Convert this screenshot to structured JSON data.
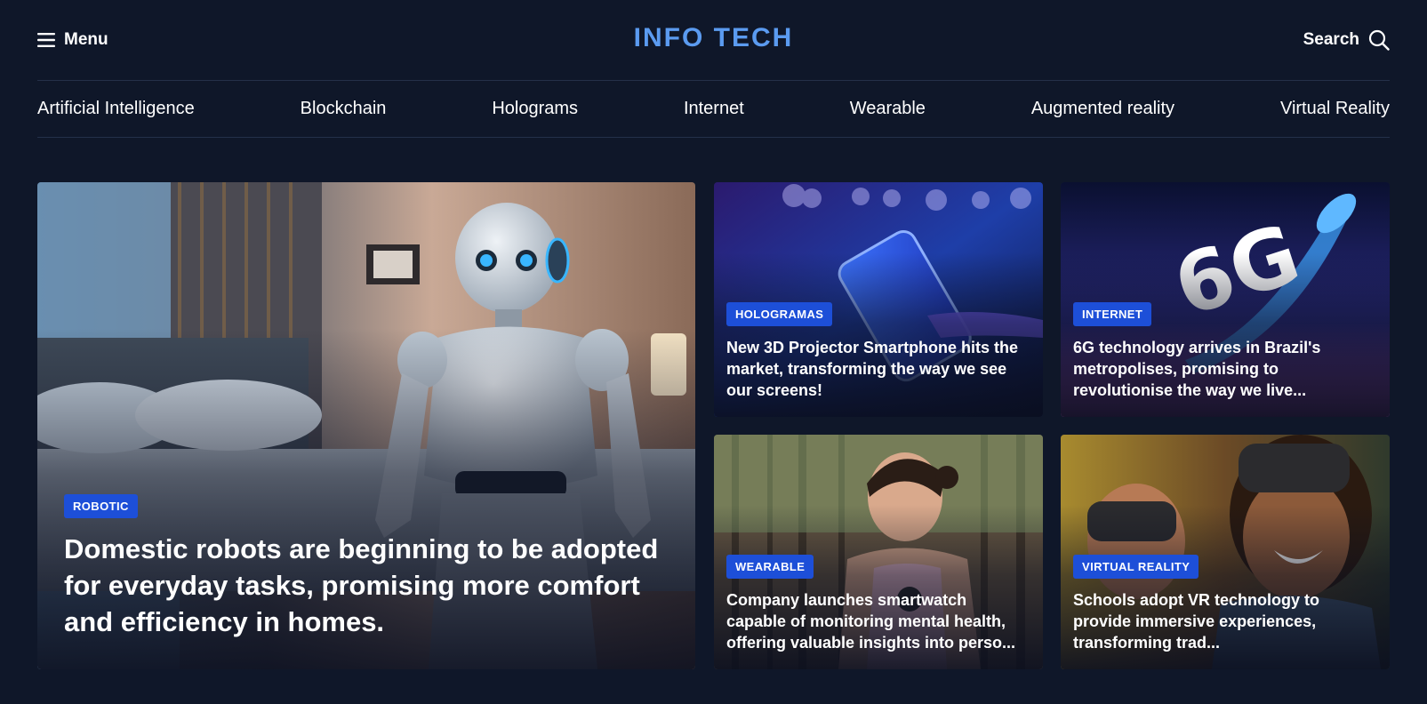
{
  "header": {
    "menu_label": "Menu",
    "brand": "INFO TECH",
    "search_label": "Search"
  },
  "nav": {
    "items": [
      "Artificial Intelligence",
      "Blockchain",
      "Holograms",
      "Internet",
      "Wearable",
      "Augmented reality",
      "Virtual Reality"
    ]
  },
  "articles": [
    {
      "badge": "ROBOTIC",
      "title": "Domestic robots are beginning to be adopted for everyday tasks, promising more comfort and efficiency in homes."
    },
    {
      "badge": "HOLOGRAMAS",
      "title": "New 3D Projector Smartphone hits the market, transforming the way we see our screens!"
    },
    {
      "badge": "INTERNET",
      "title": "6G technology arrives in Brazil's metropolises, promising to revolutionise the way we live..."
    },
    {
      "badge": "WEARABLE",
      "title": "Company launches smartwatch capable of monitoring mental health, offering valuable insights into perso..."
    },
    {
      "badge": "VIRTUAL REALITY",
      "title": "Schools adopt VR technology to provide immersive experiences, transforming trad..."
    }
  ],
  "icons": {
    "menu": "hamburger-icon",
    "search": "search-icon"
  },
  "colors": {
    "background": "#0f1729",
    "brand": "#5b9bf0",
    "badge": "#1d4fd8"
  }
}
